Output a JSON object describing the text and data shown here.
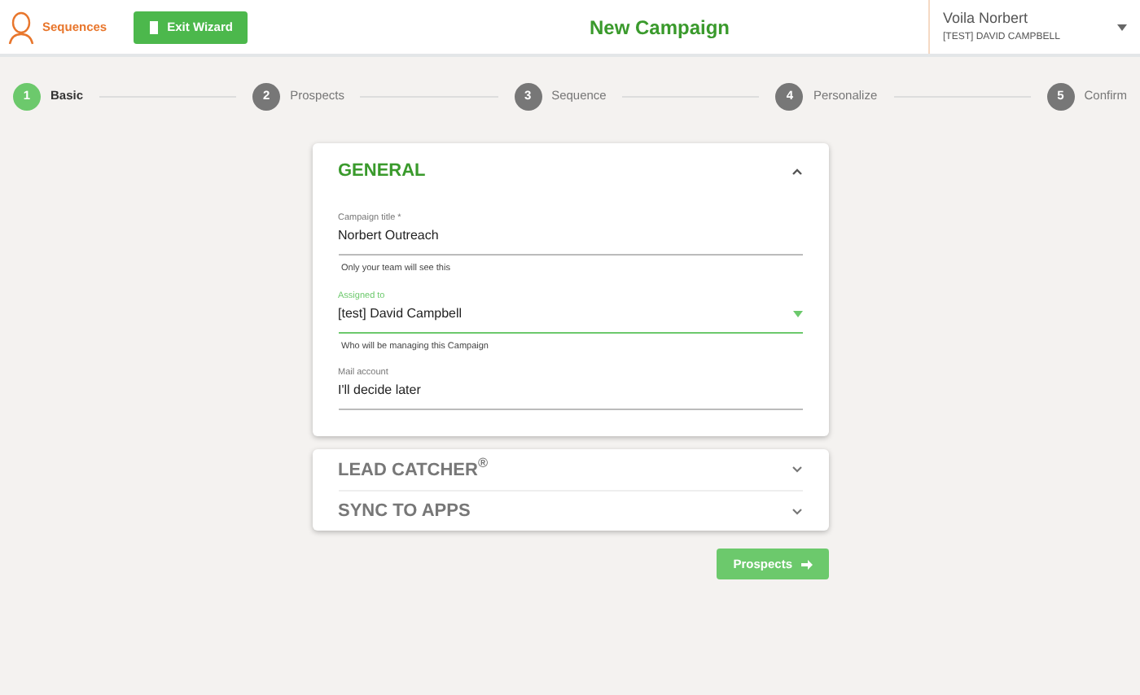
{
  "header": {
    "app_name": "Sequences",
    "exit_button": "Exit Wizard",
    "title": "New Campaign",
    "account": {
      "name": "Voila Norbert",
      "user": "[TEST] DAVID CAMPBELL"
    }
  },
  "steps": [
    {
      "number": "1",
      "label": "Basic",
      "selected": true
    },
    {
      "number": "2",
      "label": "Prospects",
      "selected": false
    },
    {
      "number": "3",
      "label": "Sequence",
      "selected": false
    },
    {
      "number": "4",
      "label": "Personalize",
      "selected": false
    },
    {
      "number": "5",
      "label": "Confirm",
      "selected": false
    }
  ],
  "general": {
    "title": "GENERAL",
    "expanded": true,
    "fields": [
      {
        "kind": "text",
        "label": "Campaign title *",
        "value": "Norbert Outreach",
        "hint": "Only your team will see this",
        "focused": false
      },
      {
        "kind": "select",
        "label": "Assigned to",
        "value": "[test] David Campbell",
        "hint": "Who will be managing this Campaign",
        "focused": true
      },
      {
        "kind": "text",
        "label": "Mail account",
        "value": "I'll decide later",
        "focused": false
      }
    ]
  },
  "sections": [
    {
      "title": "LEAD CATCHER$^{®}$",
      "expanded": false
    },
    {
      "title": "SYNC TO APPS",
      "expanded": false
    }
  ],
  "next_button": "Prospects"
}
